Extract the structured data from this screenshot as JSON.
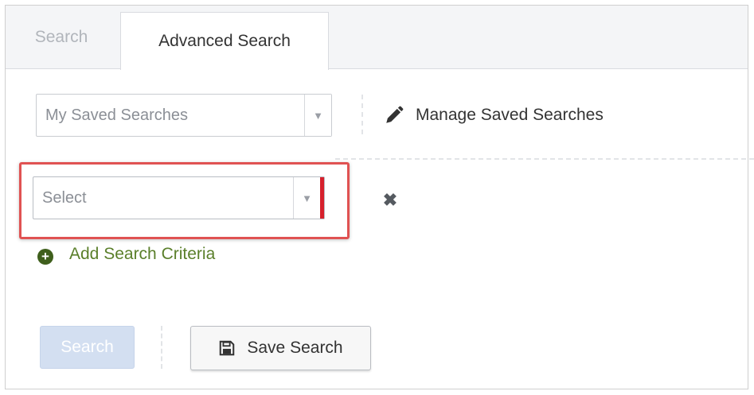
{
  "tabs": [
    {
      "label": "Search",
      "active": false
    },
    {
      "label": "Advanced Search",
      "active": true
    }
  ],
  "saved_searches": {
    "placeholder": "My Saved Searches",
    "manage_label": "Manage Saved Searches"
  },
  "criteria": {
    "select_placeholder": "Select",
    "remove_icon": "close-icon",
    "add_label": "Add Search Criteria"
  },
  "actions": {
    "search_label": "Search",
    "save_label": "Save Search"
  },
  "colors": {
    "highlight": "#e05252",
    "required_bar": "#d6202c",
    "add_link": "#5a7f2a",
    "disabled_button": "#d3dff1"
  }
}
